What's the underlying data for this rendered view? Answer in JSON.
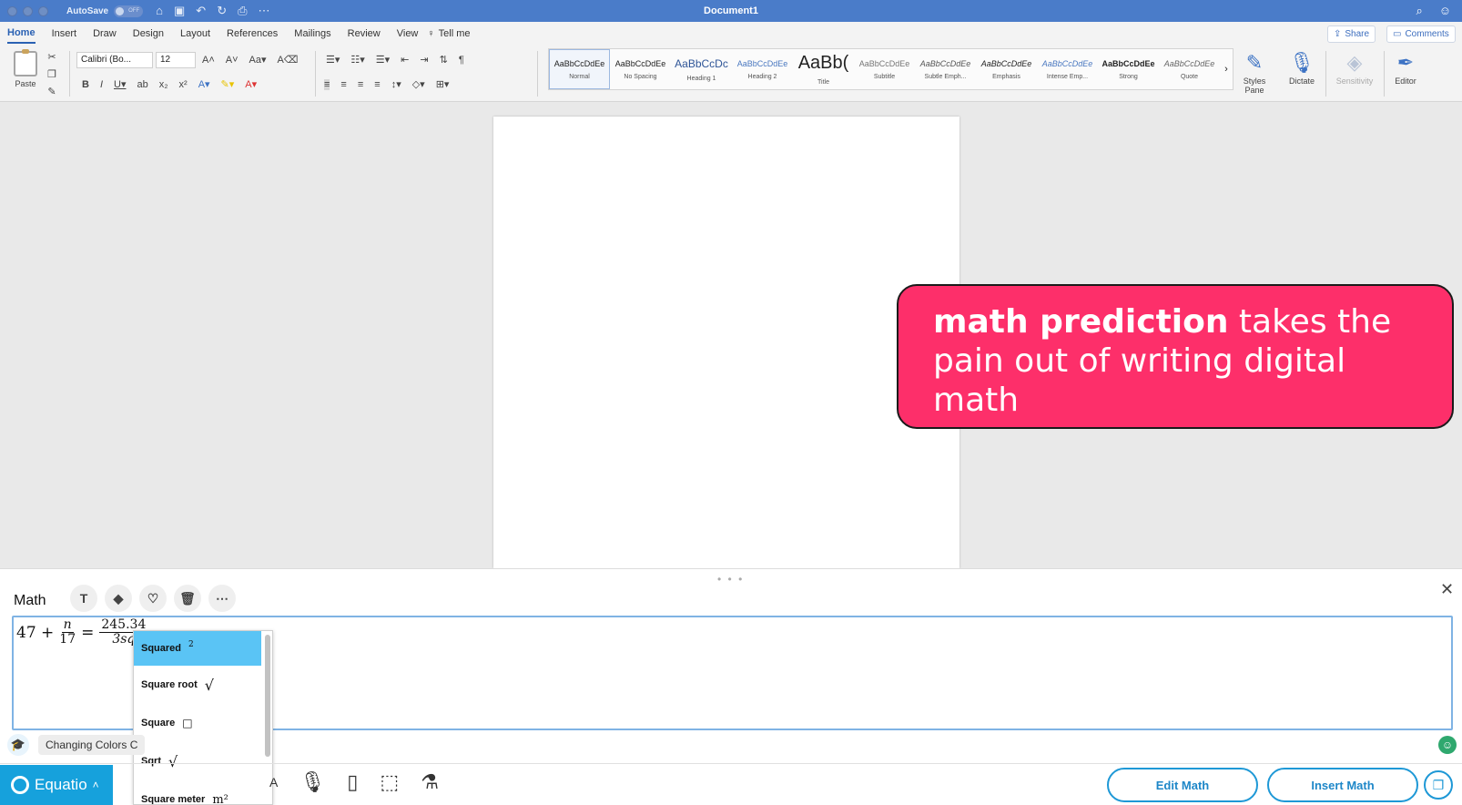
{
  "window": {
    "title": "Document1",
    "autosave_label": "AutoSave",
    "autosave_state": "OFF"
  },
  "tabs": [
    "Home",
    "Insert",
    "Draw",
    "Design",
    "Layout",
    "References",
    "Mailings",
    "Review",
    "View"
  ],
  "tell_me": "Tell me",
  "share_label": "Share",
  "comments_label": "Comments",
  "ribbon": {
    "paste_label": "Paste",
    "font_name": "Calibri (Bo...",
    "font_size": "12",
    "styles": [
      {
        "preview": "AaBbCcDdEe",
        "name": "Normal"
      },
      {
        "preview": "AaBbCcDdEe",
        "name": "No Spacing"
      },
      {
        "preview": "AaBbCcDc",
        "name": "Heading 1"
      },
      {
        "preview": "AaBbCcDdEe",
        "name": "Heading 2"
      },
      {
        "preview": "AaBb(",
        "name": "Title"
      },
      {
        "preview": "AaBbCcDdEe",
        "name": "Subtitle"
      },
      {
        "preview": "AaBbCcDdEe",
        "name": "Subtle Emph..."
      },
      {
        "preview": "AaBbCcDdEe",
        "name": "Emphasis"
      },
      {
        "preview": "AaBbCcDdEe",
        "name": "Intense Emp..."
      },
      {
        "preview": "AaBbCcDdEe",
        "name": "Strong"
      },
      {
        "preview": "AaBbCcDdEe",
        "name": "Quote"
      }
    ],
    "styles_pane_label": "Styles Pane",
    "dictate_label": "Dictate",
    "sensitivity_label": "Sensitivity",
    "editor_label": "Editor"
  },
  "callout": {
    "bold": "math prediction",
    "rest": " takes the pain out of writing digital math"
  },
  "panel": {
    "title": "Math",
    "expression": {
      "lhs": "47 +",
      "frac1_num": "n",
      "frac1_den": "17",
      "equals": "=",
      "frac2_num": "245.34",
      "frac2_den": "3sq"
    },
    "suggestions": [
      {
        "label": "Squared",
        "symbol": "2"
      },
      {
        "label": "Square root",
        "symbol": "√"
      },
      {
        "label": "Square",
        "symbol": "□"
      },
      {
        "label": "Sqrt",
        "symbol": "√"
      },
      {
        "label": "Square meter",
        "symbol": "m²"
      }
    ],
    "hint_chip": "Changing Colors C",
    "brand": "Equatio",
    "edit_math": "Edit Math",
    "insert_math": "Insert Math"
  },
  "colors": {
    "titlebar": "#4a7cc9",
    "callout": "#fd2f6a",
    "equatio": "#16a1dc",
    "suggestion_highlight": "#5ac4f5"
  }
}
